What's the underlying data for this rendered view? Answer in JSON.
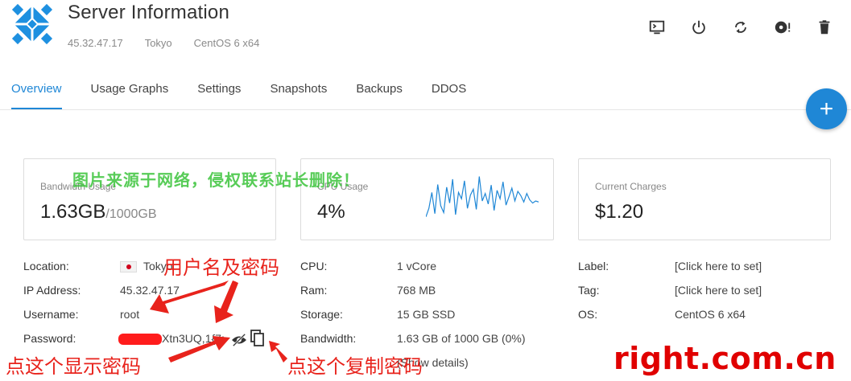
{
  "header": {
    "title": "Server Information",
    "ip": "45.32.47.17",
    "location": "Tokyo",
    "os": "CentOS 6 x64"
  },
  "toolbar": {
    "buttons": [
      {
        "icon": "console-icon"
      },
      {
        "icon": "power-icon"
      },
      {
        "icon": "restart-icon"
      },
      {
        "icon": "disc-icon"
      },
      {
        "icon": "trash-icon"
      }
    ]
  },
  "tabs": [
    "Overview",
    "Usage Graphs",
    "Settings",
    "Snapshots",
    "Backups",
    "DDOS"
  ],
  "cards": {
    "bandwidth": {
      "label": "Bandwidth Usage",
      "value": "1.63GB",
      "suffix": "/1000GB"
    },
    "cpu": {
      "label": "CPU Usage",
      "value": "4%",
      "sparkline": [
        14,
        30,
        60,
        20,
        75,
        35,
        22,
        70,
        40,
        85,
        18,
        60,
        48,
        82,
        30,
        55,
        66,
        28,
        90,
        44,
        58,
        38,
        74,
        26,
        64,
        48,
        80,
        36,
        52,
        68,
        44,
        62,
        54,
        42,
        58,
        46,
        40,
        44,
        42
      ]
    },
    "charges": {
      "label": "Current Charges",
      "value": "$1.20"
    }
  },
  "watermark": "图片来源于网络，侵权联系站长删除！",
  "details": {
    "left": [
      {
        "label": "Location:",
        "value": "Tokyo"
      },
      {
        "label": "IP Address:",
        "value": "45.32.47.17"
      },
      {
        "label": "Username:",
        "value": "root"
      },
      {
        "label": "Password:",
        "value": "Xtn3UQ,1{7:"
      }
    ],
    "middle": [
      {
        "label": "CPU:",
        "value": "1 vCore"
      },
      {
        "label": "Ram:",
        "value": "768 MB"
      },
      {
        "label": "Storage:",
        "value": "15 GB SSD"
      },
      {
        "label": "Bandwidth:",
        "value": "1.63 GB of 1000 GB (0%)"
      }
    ],
    "show_details": "(Show details)",
    "right": [
      {
        "label": "Label:",
        "value": "[Click here to set]"
      },
      {
        "label": "Tag:",
        "value": "[Click here to set]"
      },
      {
        "label": "OS:",
        "value": "CentOS 6 x64"
      }
    ]
  },
  "annotations": {
    "username_password": "用户名及密码",
    "show_password": "点这个显示密码",
    "copy_password": "点这个复制密码",
    "site": "right.com.cn"
  },
  "colors": {
    "accent": "#1f87d6",
    "annotation": "#e8231c",
    "watermark": "#3bc43b"
  }
}
